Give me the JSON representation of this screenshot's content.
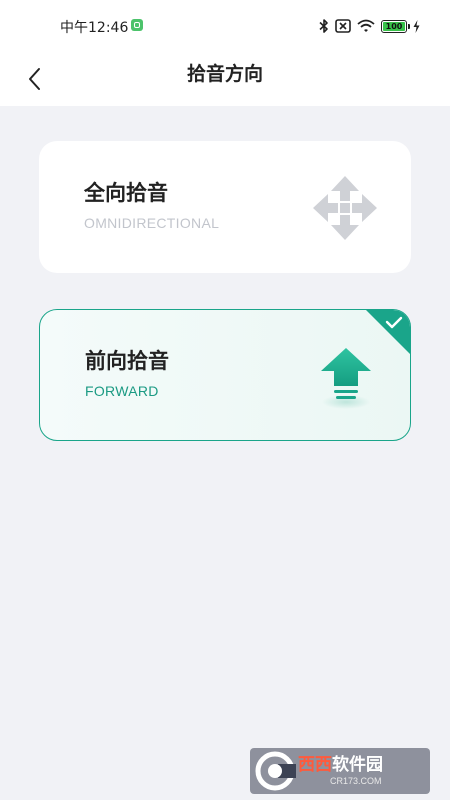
{
  "status_bar": {
    "time": "中午12:46",
    "battery_level": "100",
    "icons": [
      "app-notification-icon",
      "bluetooth-icon",
      "sim-absent-icon",
      "wifi-icon",
      "battery-icon",
      "charging-icon"
    ]
  },
  "header": {
    "title": "拾音方向",
    "back_icon": "chevron-left-icon"
  },
  "options": [
    {
      "title": "全向拾音",
      "subtitle": "OMNIDIRECTIONAL",
      "icon": "four-way-arrows-icon",
      "selected": false
    },
    {
      "title": "前向拾音",
      "subtitle": "FORWARD",
      "icon": "up-arrow-icon",
      "selected": true
    }
  ],
  "colors": {
    "accent": "#1aa58a",
    "background": "#f1f2f6",
    "card": "#ffffff",
    "inactive_icon": "#cfd1d6",
    "inactive_text": "#c2c5cc"
  },
  "watermark": {
    "brand_left": "西西",
    "brand_right": "软件园",
    "url": "CR173.COM"
  }
}
